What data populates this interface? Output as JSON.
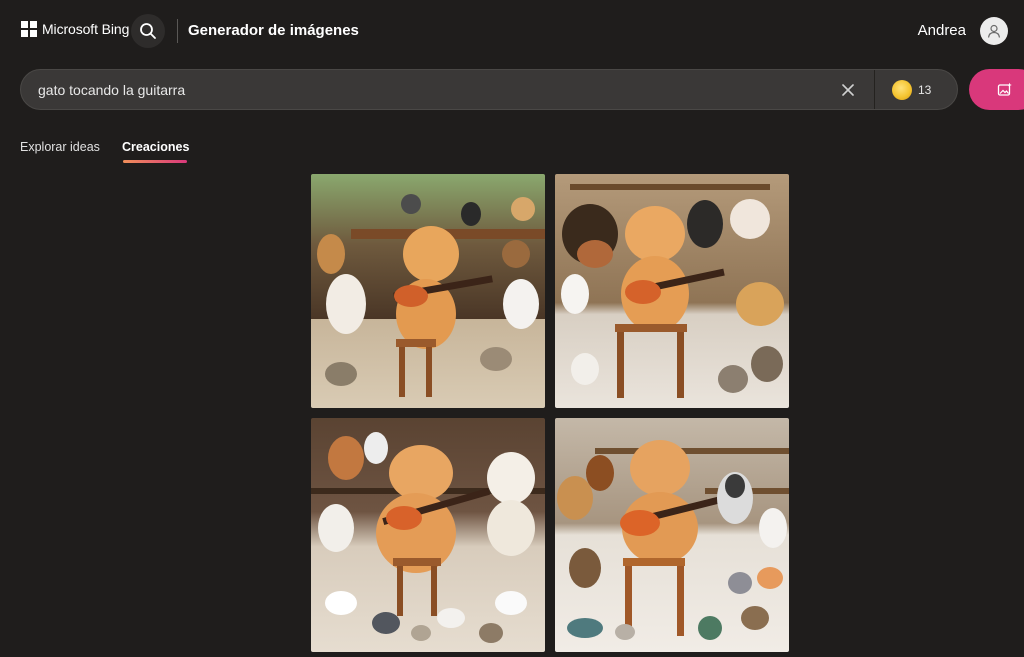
{
  "header": {
    "brand": "Microsoft Bing",
    "app_title": "Generador de imágenes",
    "user_name": "Andrea"
  },
  "search": {
    "query": "gato tocando la guitarra",
    "coins": "13"
  },
  "tabs": [
    {
      "label": "Explorar ideas",
      "active": false
    },
    {
      "label": "Creaciones",
      "active": true
    }
  ],
  "gallery": {
    "images": [
      {
        "subject": "cat-playing-guitar-with-animals-1"
      },
      {
        "subject": "cat-playing-guitar-with-animals-2"
      },
      {
        "subject": "cat-playing-guitar-with-animals-3"
      },
      {
        "subject": "cat-playing-guitar-with-animals-4"
      }
    ]
  },
  "colors": {
    "background": "#1f1d1c",
    "accent": "#d9387b",
    "tab_underline_start": "#f08f5a"
  },
  "icons": [
    "windows-logo-icon",
    "search-icon",
    "user-icon",
    "close-icon",
    "coin-icon",
    "create-image-icon"
  ]
}
